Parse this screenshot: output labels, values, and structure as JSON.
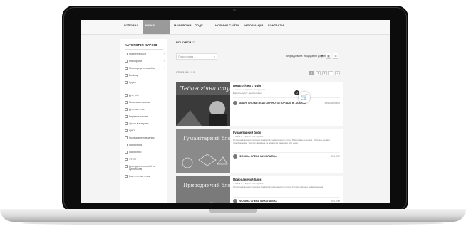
{
  "nav": {
    "items": [
      {
        "label": "ГОЛОВНА",
        "sub": ""
      },
      {
        "label": "КУРСИ",
        "sub": ""
      },
      {
        "label": "МАРАФОНИ",
        "sub": ""
      },
      {
        "label": "ПОДІЇ",
        "sub": ""
      },
      {
        "label": "НОВИНИ САЙТУ",
        "sub": ""
      },
      {
        "label": "ІНФОРМАЦІЯ",
        "sub": ""
      },
      {
        "label": "КОНТАКТИ",
        "sub": ""
      }
    ],
    "active_index": 1
  },
  "sidebar": {
    "title": "КАТЕГОРІЯ КУРСІВ",
    "top_items": [
      {
        "label": "Майстеркласи",
        "arrow": "›"
      },
      {
        "label": "Марафони",
        "arrow": "›"
      },
      {
        "label": "Мовнорецепт скарбів",
        "arrow": "›"
      },
      {
        "label": "Вебінар",
        "arrow": ""
      },
      {
        "label": "Курси",
        "arrow": ""
      }
    ],
    "bottom_items": [
      {
        "label": "Для усіх"
      },
      {
        "label": "Початкова школа"
      },
      {
        "label": "Для вчителів"
      },
      {
        "label": "Керівникам шкіл"
      },
      {
        "label": "Уроки в інтернет"
      },
      {
        "label": "ЦНО"
      },
      {
        "label": "Інклюзивне навчання"
      },
      {
        "label": "Психологія"
      },
      {
        "label": "Психолого"
      },
      {
        "label": "STEM"
      },
      {
        "label": "Дослідження в сім'ї та суспільстві"
      },
      {
        "label": "Вчитель вчителям"
      }
    ]
  },
  "toolbar": {
    "all_label": "ВСІ КУРСИ",
    "all_count": "(9)",
    "search_placeholder": "Пошук курсів ...",
    "search_icon": "search-icon",
    "sort_label": "Впорядкувати: нещодавно додані",
    "sort_caret": "▾",
    "view_grid": "▦",
    "view_list": "☰"
  },
  "pagination": {
    "info": "СТОРІНКА 1 З 9",
    "pages": [
      "1",
      "2",
      "3",
      "›",
      "»"
    ],
    "active_index": 0
  },
  "courses": [
    {
      "thumb_text": "Педагогічна студія",
      "title": "Педагогічна студія",
      "meta": "☆☆☆☆☆ 0 відгуків · 0 студентів",
      "desc": "Вартість курсу: безкоштовно",
      "author": "АВАНГОЛОВА ПЕДАГОГІЧНОГО ПОРТАЛУ В. АСАНОВ",
      "price": "Безкоштовно"
    },
    {
      "thumb_text": "Гуманітарний блок",
      "title": "Гуманітарний блок",
      "meta": "★★★★★ 1 відгук · 2 студенти",
      "desc": "Огляд навчальних програм предметів гуманітарного блоку. Підготовка до уроків. Робота з онлайн платформами. Тестові завдання та практичні завдання для учнів.",
      "author": "ФОМІНА ОЛЕНА МИКОЛАЇВНА",
      "price": "550.00₴"
    },
    {
      "thumb_text": "Природничий блок",
      "title": "Природничий блок",
      "meta": "★★★★★ 1 відгук · 2 студенти",
      "desc": "Огляд навчальних програм предметів природничого блоку. Сучасні підходи до викладання.",
      "author": "ФОМІНА ОЛЕНА МИКОЛАЇВНА",
      "price": "550.00₴"
    }
  ],
  "cart": {
    "count": "0",
    "icon": "cart-icon"
  }
}
